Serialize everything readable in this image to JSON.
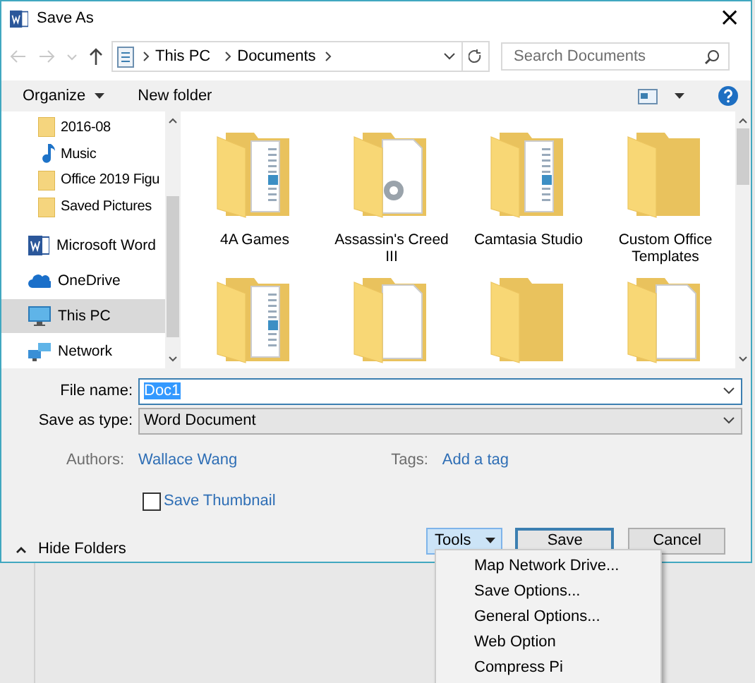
{
  "window": {
    "title": "Save As",
    "close": "×"
  },
  "address_bar": {
    "path": [
      {
        "label": "This PC"
      },
      {
        "label": "Documents"
      }
    ]
  },
  "search": {
    "placeholder": "Search Documents"
  },
  "toolbar": {
    "organize": "Organize",
    "new_folder": "New folder"
  },
  "nav_pane": {
    "subfolders": [
      {
        "label": "2016-08",
        "kind": "folder",
        "selected": false
      },
      {
        "label": "Music",
        "kind": "music",
        "selected": false
      },
      {
        "label": "Office 2019 Figu",
        "kind": "folder",
        "selected": false
      },
      {
        "label": "Saved Pictures",
        "kind": "folder",
        "selected": false
      }
    ],
    "items": [
      {
        "label": "Microsoft Word",
        "kind": "word",
        "selected": false
      },
      {
        "label": "OneDrive",
        "kind": "onedrive",
        "selected": false
      },
      {
        "label": "This PC",
        "kind": "pc",
        "selected": true
      },
      {
        "label": "Network",
        "kind": "network",
        "selected": false
      }
    ]
  },
  "folders": [
    {
      "name": "4A Games",
      "kind": "doc"
    },
    {
      "name": "Assassin's Creed III",
      "kind": "gear"
    },
    {
      "name": "Camtasia Studio",
      "kind": "doc"
    },
    {
      "name": "Custom Office Templates",
      "kind": "plain"
    },
    {
      "kind": "doc"
    },
    {
      "kind": "blank"
    },
    {
      "kind": "plain"
    },
    {
      "kind": "blank"
    }
  ],
  "form": {
    "file_name": {
      "label": "File name:",
      "value": "Doc1"
    },
    "save_as_type": {
      "label": "Save as type:",
      "value": "Word Document"
    },
    "authors": {
      "label": "Authors:",
      "value": "Wallace Wang"
    },
    "tags": {
      "label": "Tags:",
      "value": "Add a tag"
    },
    "save_thumbnail": {
      "label": "Save Thumbnail",
      "checked": false
    }
  },
  "footer": {
    "hide_folders": "Hide Folders",
    "tools": "Tools",
    "save": "Save",
    "cancel": "Cancel"
  },
  "tools_menu": [
    {
      "label": "Map Network Drive..."
    },
    {
      "label": "Save Options..."
    },
    {
      "label": "General Options..."
    },
    {
      "label": "Web Option"
    },
    {
      "label": "Compress Pi"
    }
  ]
}
